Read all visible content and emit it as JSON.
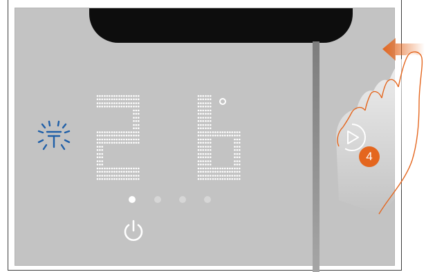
{
  "thermostat": {
    "temperature_digits": [
      "2",
      "6"
    ],
    "unit_symbol": "°",
    "mode_icon": "ventilation-icon",
    "power_icon": "power-icon",
    "pages": {
      "total": 4,
      "active_index": 0
    }
  },
  "gesture": {
    "action": "swipe-left",
    "step_number": "4",
    "icons": [
      "swipe-arrow-left-icon",
      "hand-icon",
      "play-icon"
    ]
  },
  "colors": {
    "panel": "#c3c3c3",
    "notch": "#0d0d0d",
    "accent_orange": "#e4661e",
    "mode_icon_blue": "#1f5fa8",
    "display_dots": "#ffffff"
  }
}
